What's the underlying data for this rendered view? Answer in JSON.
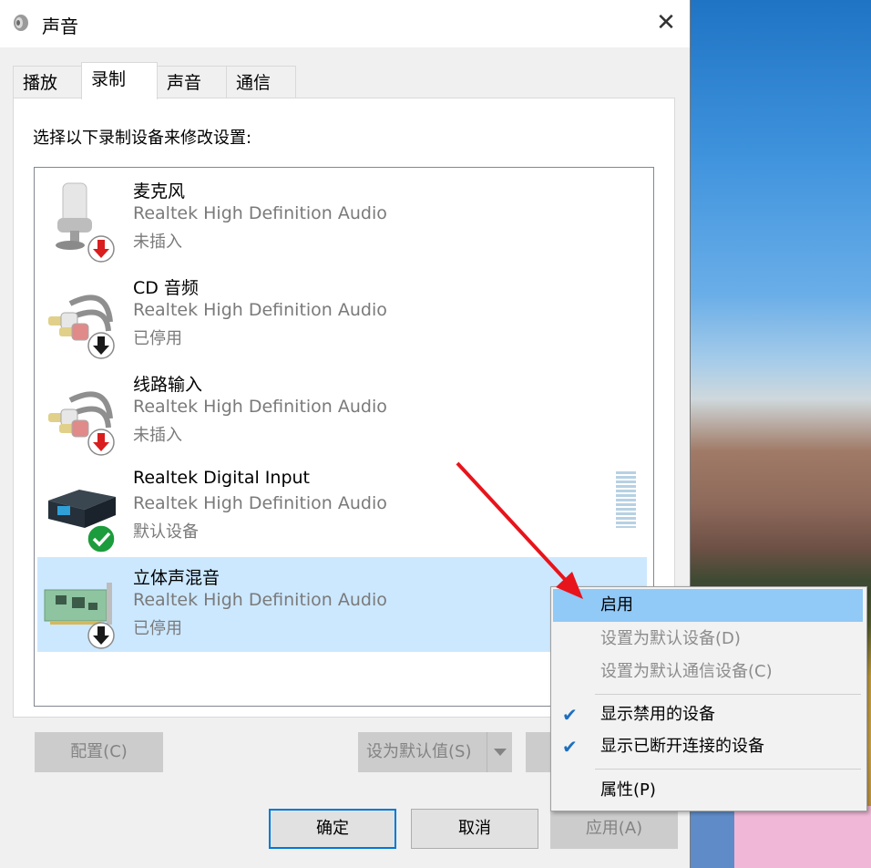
{
  "window": {
    "title": "声音",
    "close_glyph": "✕"
  },
  "tabs": [
    {
      "label": "播放",
      "active": false
    },
    {
      "label": "录制",
      "active": true
    },
    {
      "label": "声音",
      "active": false
    },
    {
      "label": "通信",
      "active": false
    }
  ],
  "instruction": "选择以下录制设备来修改设置:",
  "devices": [
    {
      "name": "麦克风",
      "driver": "Realtek High Definition Audio",
      "status": "未插入",
      "icon": "microphone-icon",
      "badge": "unplugged-badge"
    },
    {
      "name": "CD 音频",
      "driver": "Realtek High Definition Audio",
      "status": "已停用",
      "icon": "rca-cable-icon",
      "badge": "disabled-badge"
    },
    {
      "name": "线路输入",
      "driver": "Realtek High Definition Audio",
      "status": "未插入",
      "icon": "rca-cable-icon",
      "badge": "unplugged-badge"
    },
    {
      "name": "Realtek Digital Input",
      "driver": "Realtek High Definition Audio",
      "status": "默认设备",
      "icon": "digital-input-box-icon",
      "badge": "default-check-badge"
    },
    {
      "name": "立体声混音",
      "driver": "Realtek High Definition Audio",
      "status": "已停用",
      "icon": "sound-card-icon",
      "badge": "disabled-badge",
      "selected": true
    }
  ],
  "buttons": {
    "configure": "配置(C)",
    "set_default": "设为默认值(S)",
    "properties": "属性(P)",
    "ok": "确定",
    "cancel": "取消",
    "apply": "应用(A)"
  },
  "context_menu": [
    {
      "label": "启用",
      "highlighted": true
    },
    {
      "label": "设置为默认设备(D)",
      "disabled": true
    },
    {
      "label": "设置为默认通信设备(C)",
      "disabled": true
    },
    {
      "label": "显示禁用的设备",
      "checked": true
    },
    {
      "label": "显示已断开连接的设备",
      "checked": true
    },
    {
      "label": "属性(P)"
    }
  ],
  "colors": {
    "selection": "#cce8ff",
    "menu_highlight": "#91c9f7",
    "accent": "#0078d7",
    "annotation_arrow": "#e8141b"
  }
}
